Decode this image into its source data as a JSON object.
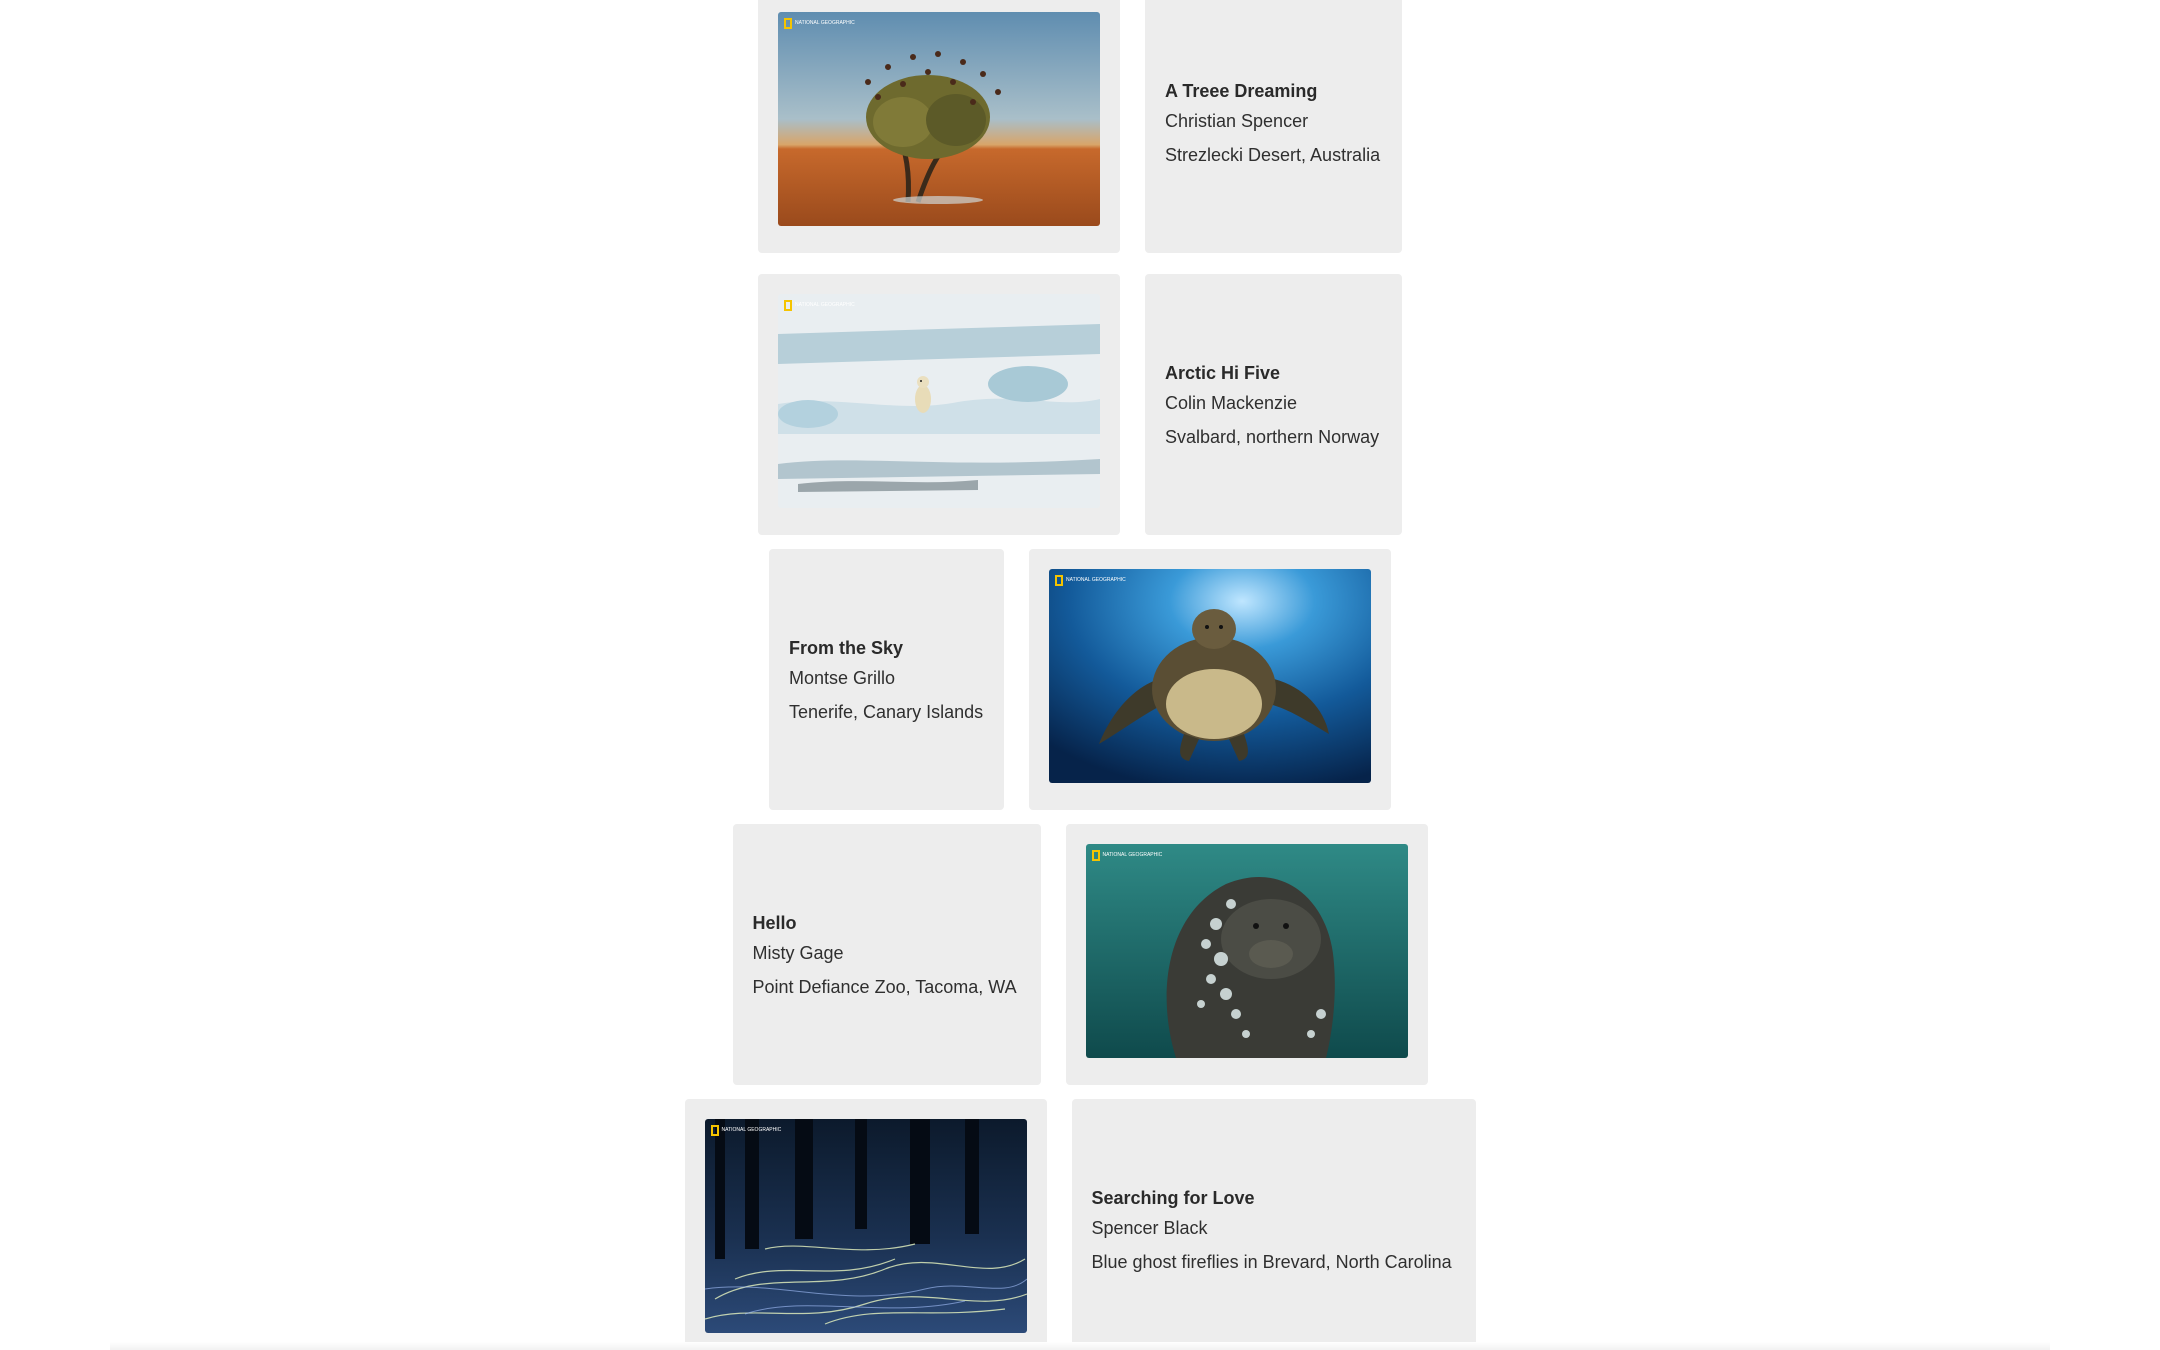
{
  "brand": {
    "logo_text": "NATIONAL GEOGRAPHIC",
    "logo_color": "#f5c400"
  },
  "card_background": "#ededed",
  "photos": [
    {
      "title": "A Treee Dreaming",
      "author": "Christian Spencer",
      "location": "Strezlecki Desert, Australia",
      "layout": "photo-left",
      "scene": "tree-with-birds"
    },
    {
      "title": "Arctic Hi Five",
      "author": "Colin Mackenzie",
      "location": "Svalbard, northern Norway",
      "layout": "photo-left",
      "scene": "polar-bear-ice"
    },
    {
      "title": "From the Sky",
      "author": "Montse Grillo",
      "location": "Tenerife, Canary Islands",
      "layout": "photo-right",
      "scene": "sea-turtle"
    },
    {
      "title": "Hello",
      "author": "Misty Gage",
      "location": "Point Defiance Zoo, Tacoma, WA",
      "layout": "photo-right",
      "scene": "walrus-underwater"
    },
    {
      "title": "Searching for Love",
      "author": "Spencer Black",
      "location": "Blue ghost fireflies in Brevard, North Carolina",
      "layout": "photo-left",
      "scene": "firefly-forest"
    }
  ]
}
